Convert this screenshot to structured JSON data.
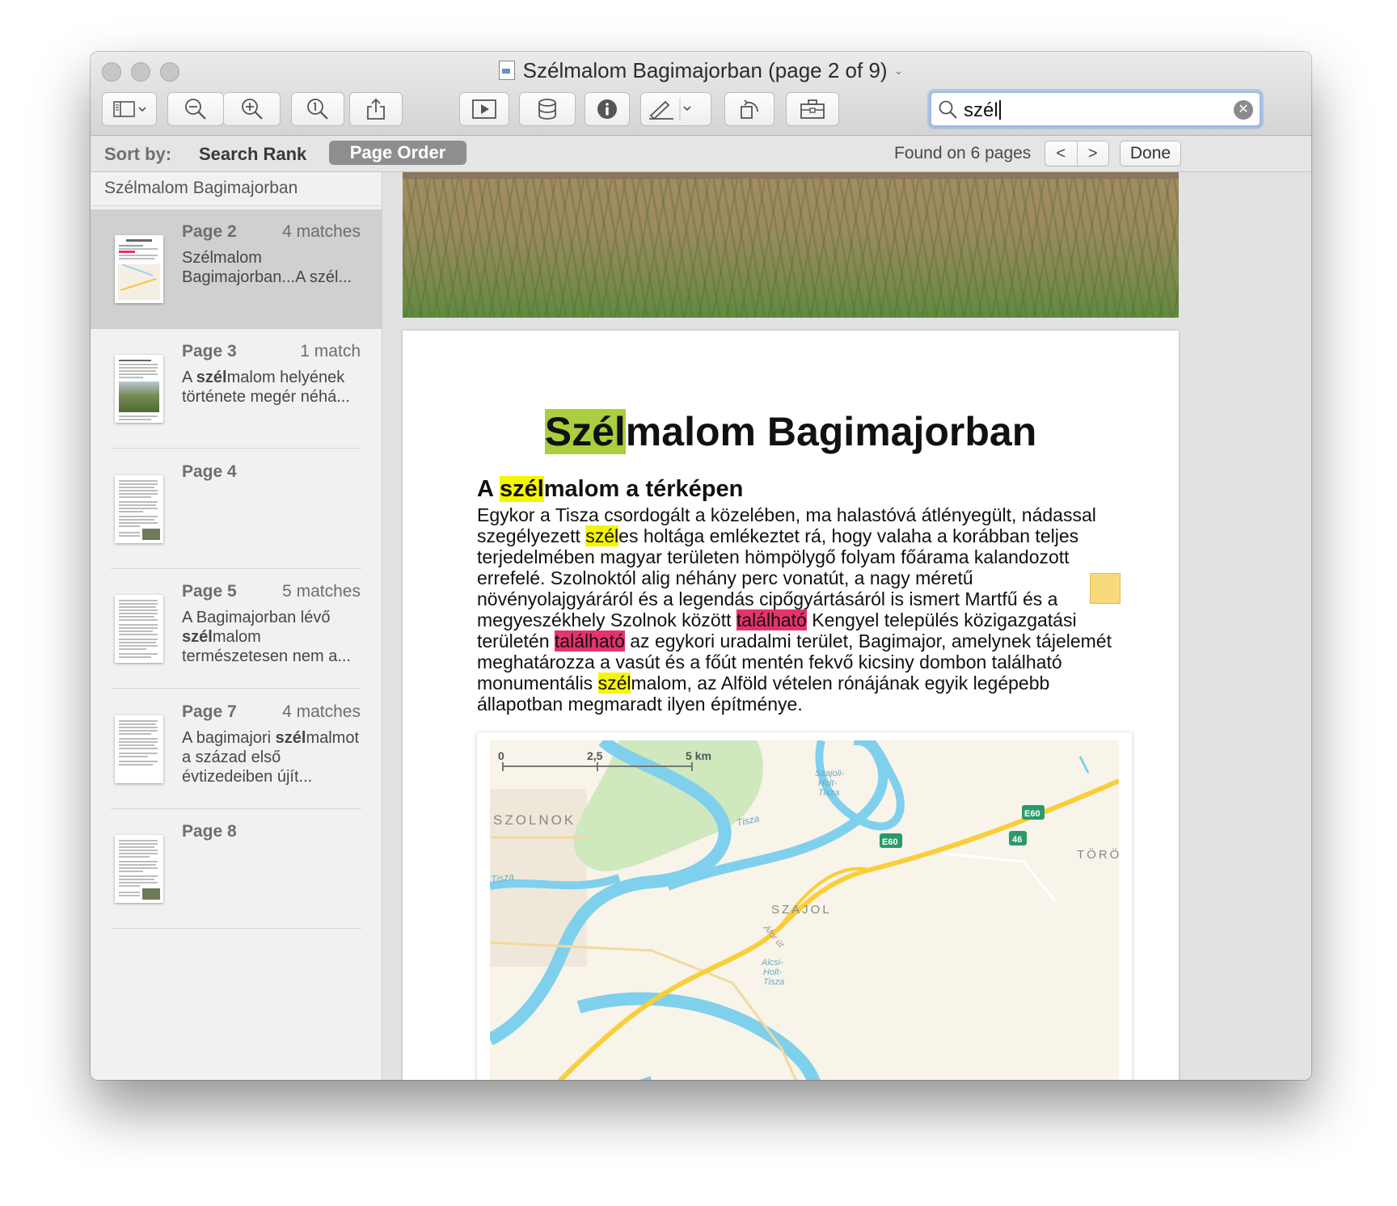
{
  "window": {
    "title": "Szélmalom Bagimajorban (page 2 of 9)"
  },
  "toolbar": {
    "search_value": "szél"
  },
  "findbar": {
    "sort_label": "Sort by:",
    "sort_rank": "Search Rank",
    "sort_page_order": "Page Order",
    "found_text": "Found on 6 pages",
    "prev": "<",
    "next": ">",
    "done": "Done"
  },
  "sidebar": {
    "doc_title": "Szélmalom Bagimajorban",
    "results": [
      {
        "page": "Page 2",
        "matches": "4 matches",
        "snippet_parts": [
          "Szélmalom Bagimajorban...A szél..."
        ]
      },
      {
        "page": "Page 3",
        "matches": "1 match",
        "snippet_parts": [
          "A ",
          "szél",
          "malom helyének története megér néhá..."
        ]
      },
      {
        "page": "Page 4",
        "matches": "",
        "snippet_parts": []
      },
      {
        "page": "Page 5",
        "matches": "5 matches",
        "snippet_parts": [
          "A Bagimajorban lévő ",
          "szél",
          "malom természetesen nem a..."
        ]
      },
      {
        "page": "Page 7",
        "matches": "4 matches",
        "snippet_parts": [
          "A bagimajori ",
          "szél",
          "malmot a század első évtizedeiben újít..."
        ]
      },
      {
        "page": "Page 8",
        "matches": "",
        "snippet_parts": []
      }
    ]
  },
  "document": {
    "title_hl": "Szél",
    "title_rest": "malom Bagimajorban",
    "h2_pre": "A ",
    "h2_hl": "szél",
    "h2_rest": "malom a térképen",
    "lines": [
      [
        "Egykor a Tisza csordogált a közelében, ma halastóvá átlényegült, nádassal"
      ],
      [
        "szegélyezett ",
        "szél",
        "es holtága emlékeztet rá, hogy valaha a korábban teljes"
      ],
      [
        "terjedelmében magyar területen hömpölygő folyam főárama kalandozott"
      ],
      [
        "errefelé. Szolnoktól alig néhány perc vonatút, a nagy méretű"
      ],
      [
        "növényolajgyáráról és a legendás cipőgyártásáról is ismert Martfű és a"
      ],
      [
        "megyeszékhely Szolnok között ",
        "található",
        " Kengyel település közigazgatási"
      ],
      [
        "területén ",
        "található",
        " az egykori uradalmi terület, Bagimajor, amelynek tájelemét"
      ],
      [
        "meghatározza a vasút és a főút mentén fekvő kicsiny dombon található"
      ],
      [
        "monumentális ",
        "szél",
        "malom, az Alföld vételen rónájának egyik legépebb"
      ],
      [
        "állapotban megmaradt ilyen építménye."
      ]
    ],
    "line_hl_colors": [
      "",
      "y",
      "",
      "",
      "",
      "r",
      "r",
      "",
      "y",
      ""
    ],
    "map": {
      "scale_0": "0",
      "scale_mid": "2,5",
      "scale_end": "5 km",
      "city_szolnok": "SZOLNOK",
      "city_szajol": "SZAJOL",
      "city_torok": "TÖRÖK",
      "river_tisza_1": "Tisza",
      "river_tisza_2": "Tisza",
      "lake_szajoli_1": "Szajoli-",
      "lake_szajoli_2": "Holt-",
      "lake_szajoli_3": "Tisza",
      "lake_alcsi_1": "Alcsi-",
      "lake_alcsi_2": "Holt-",
      "lake_alcsi_3": "Tisza",
      "road_afor": "Afor út",
      "route_e60_a": "E60",
      "route_e60_b": "E60",
      "route_46": "46"
    }
  },
  "colors": {
    "highlight_current": "#a9cf3e",
    "highlight_match": "#f6f600",
    "highlight_other": "#e5336b",
    "water": "#7fd0ec",
    "road_main": "#f8cf3a"
  }
}
